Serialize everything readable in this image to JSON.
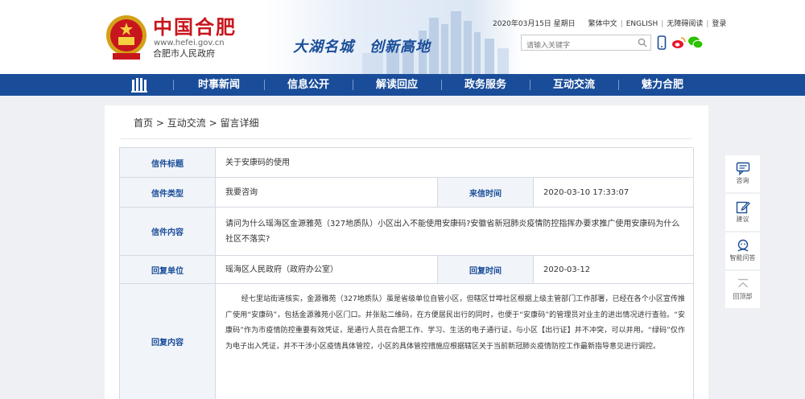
{
  "header": {
    "site_name": "中国合肥",
    "site_url": "www.hefei.gov.cn",
    "site_subtitle": "合肥市人民政府",
    "slogan": "大湖名城　创新高地",
    "date": "2020年03月15日 星期日",
    "links": [
      "繁体中文",
      "ENGLISH",
      "无障碍阅读",
      "登录"
    ],
    "search_placeholder": "请输入关键字",
    "icons": [
      "mobile-icon",
      "weibo-icon",
      "wechat-icon"
    ]
  },
  "nav": {
    "items": [
      "时事新闻",
      "信息公开",
      "解读回应",
      "政务服务",
      "互动交流",
      "魅力合肥"
    ]
  },
  "breadcrumb": [
    "首页",
    "互动交流",
    "留言详细"
  ],
  "letter": {
    "title_label": "信件标题",
    "title_value": "关于安康码的使用",
    "type_label": "信件类型",
    "type_value": "我要咨询",
    "date_label": "来信时间",
    "date_value": "2020-03-10 17:33:07",
    "content_label": "信件内容",
    "content_value": "请问为什么瑶海区金源雅苑（327地质队）小区出入不能使用安康码?安徽省新冠肺炎疫情防控指挥办要求推广使用安康码为什么社区不落实?",
    "reply_unit_label": "回复单位",
    "reply_unit_value": "瑶海区人民政府（政府办公室）",
    "reply_date_label": "回复时间",
    "reply_date_value": "2020-03-12",
    "reply_content_label": "回复内容",
    "reply_content_value": "经七里站街道核实，金源雅苑（327地质队）虽是省级单位自管小区，但辖区廿埠社区根据上级主管部门工作部署，已经在各个小区宣传推广使用“安康码”，包括金源雅苑小区门口。并张贴二维码，在方便居民出行的同时，也便于“安康码”的管理员对业主的进出情况进行查验。“安康码”作为市疫情防控重要有效凭证，是通行人员在合肥工作、学习、生活的电子通行证，与小区【出行证】并不冲突，可以并用。“绿码”仅作为电子出入凭证，并不干涉小区疫情具体管控，小区的具体管控措施应根据辖区关于当前新冠肺炎疫情防控工作最新指导意见进行调控。"
  },
  "sidebar": {
    "items": [
      "咨询",
      "建议",
      "智能问答",
      "回顶部"
    ]
  },
  "colors": {
    "nav_blue": "#1a4d99",
    "brand_red": "#c8161d",
    "label_bg": "#f1f4f9"
  }
}
